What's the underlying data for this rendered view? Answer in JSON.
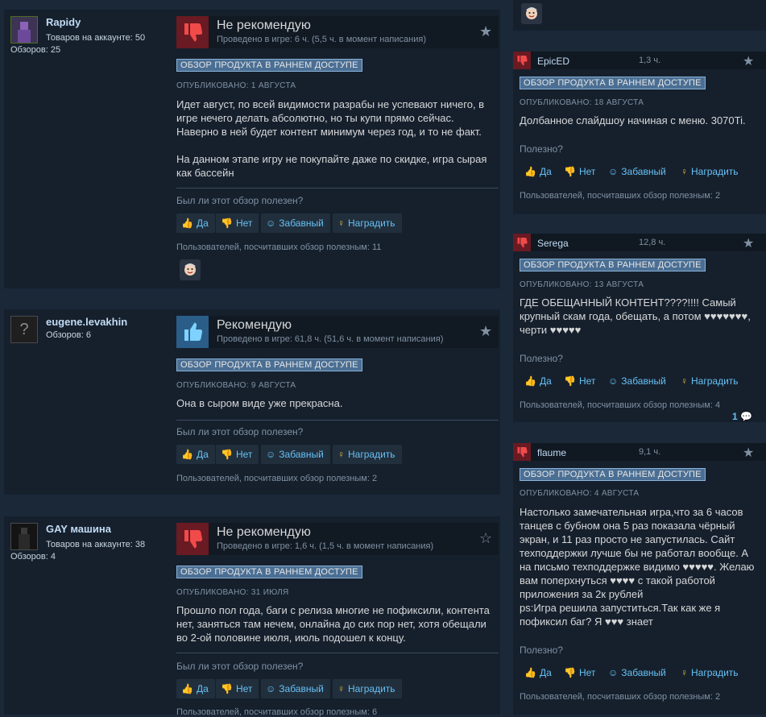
{
  "reviews": [
    {
      "username": "Rapidy",
      "products_owned": "Товаров на аккаунте: 50",
      "reviews_count": "Обзоров: 25",
      "verdict": "Не рекомендую",
      "hours": "Проведено в игре: 6 ч. (5,5 ч. в момент написания)",
      "early_access": "ОБЗОР ПРОДУКТА В РАННЕМ ДОСТУПЕ",
      "posted": "ОПУБЛИКОВАНО: 1 АВГУСТА",
      "text": "Идет август, по всей видимости разрабы не успевают ничего, в игре нечего делать абсолютно, но ты купи прямо сейчас. Наверно в ней будет контент минимум через год, и то не факт.\n\nНа данном этапе игру не покупайте даже по скидке, игра сырая как бассейн",
      "helpful_q": "Был ли этот обзор полезен?",
      "btn_yes": "Да",
      "btn_no": "Нет",
      "btn_funny": "Забавный",
      "btn_award": "Наградить",
      "helpful_count": "Пользователей, посчитавших обзор полезным: 11"
    },
    {
      "username": "eugene.levakhin",
      "reviews_count": "Обзоров: 6",
      "verdict": "Рекомендую",
      "hours": "Проведено в игре: 61,8 ч. (51,6 ч. в момент написания)",
      "early_access": "ОБЗОР ПРОДУКТА В РАННЕМ ДОСТУПЕ",
      "posted": "ОПУБЛИКОВАНО: 9 АВГУСТА",
      "text": "Она в сыром виде уже прекрасна.",
      "helpful_q": "Был ли этот обзор полезен?",
      "btn_yes": "Да",
      "btn_no": "Нет",
      "btn_funny": "Забавный",
      "btn_award": "Наградить",
      "helpful_count": "Пользователей, посчитавших обзор полезным: 2"
    },
    {
      "username": "GAY машина",
      "products_owned": "Товаров на аккаунте: 38",
      "reviews_count": "Обзоров: 4",
      "verdict": "Не рекомендую",
      "hours": "Проведено в игре: 1,6 ч. (1,5 ч. в момент написания)",
      "early_access": "ОБЗОР ПРОДУКТА В РАННЕМ ДОСТУПЕ",
      "posted": "ОПУБЛИКОВАНО: 31 ИЮЛЯ",
      "text": "Прошло пол года, баги с релиза многие не пофиксили, контента нет, заняться там нечем, онлайна до сих пор нет, хотя обещали во 2-ой половине июля, июль подошел к концу.",
      "helpful_q": "Был ли этот обзор полезен?",
      "btn_yes": "Да",
      "btn_no": "Нет",
      "btn_funny": "Забавный",
      "btn_award": "Наградить",
      "helpful_count": "Пользователей, посчитавших обзор полезным: 6"
    }
  ],
  "side_reviews": [
    {
      "username": "EpicED",
      "hours": "1,3 ч.",
      "early_access": "ОБЗОР ПРОДУКТА В РАННЕМ ДОСТУПЕ",
      "posted": "ОПУБЛИКОВАНО: 18 АВГУСТА",
      "text": "Долбанное слайдшоу начиная с меню. 3070Ti.",
      "helpful_q": "Полезно?",
      "btn_yes": "Да",
      "btn_no": "Нет",
      "btn_funny": "Забавный",
      "btn_award": "Наградить",
      "helpful_count": "Пользователей, посчитавших обзор полезным: 2"
    },
    {
      "username": "Serega",
      "hours": "12,8 ч.",
      "early_access": "ОБЗОР ПРОДУКТА В РАННЕМ ДОСТУПЕ",
      "posted": "ОПУБЛИКОВАНО: 13 АВГУСТА",
      "text": "ГДЕ ОБЕЩАННЫЙ КОНТЕНТ????!!!! Самый крупный скам года, обещать, а потом ♥♥♥♥♥♥♥, черти ♥♥♥♥♥",
      "helpful_q": "Полезно?",
      "btn_yes": "Да",
      "btn_no": "Нет",
      "btn_funny": "Забавный",
      "btn_award": "Наградить",
      "helpful_count": "Пользователей, посчитавших обзор полезным: 4",
      "comments": "1"
    },
    {
      "username": "flaume",
      "hours": "9,1 ч.",
      "early_access": "ОБЗОР ПРОДУКТА В РАННЕМ ДОСТУПЕ",
      "posted": "ОПУБЛИКОВАНО: 4 АВГУСТА",
      "text": "Настолько замечательная игра,что за 6 часов танцев с бубном она 5 раз показала чёрный экран, и 11 раз просто не запустилась. Сайт техподдержки лучше бы не работал вообще. А на письмо техподдержке видимо ♥♥♥♥♥. Желаю вам поперхнуться ♥♥♥♥ с такой работой приложения за 2к рублей\nps:Игра решила запуститься.Так как же я пофиксил баг? Я ♥♥♥ знает",
      "helpful_q": "Полезно?",
      "btn_yes": "Да",
      "btn_no": "Нет",
      "btn_funny": "Забавный",
      "btn_award": "Наградить",
      "helpful_count": "Пользователей, посчитавших обзор полезным: 2"
    }
  ],
  "colors": {
    "background": "#1b2838",
    "panel": "#16202d",
    "link": "#66c0f4",
    "badge": "#4b6f94",
    "not_recommended": "#6a1a22",
    "recommended": "#2a5e88"
  }
}
